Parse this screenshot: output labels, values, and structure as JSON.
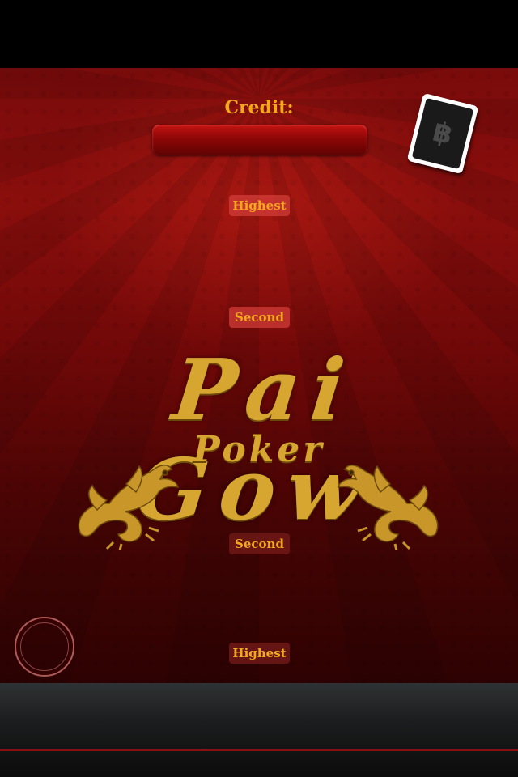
{
  "credit": {
    "label": "Credit:",
    "value": ""
  },
  "hands": {
    "dealer_high": "Highest",
    "dealer_second": "Second",
    "player_second": "Second",
    "player_high": "Highest"
  },
  "logo": {
    "title": "Pai Gow",
    "subtitle": "Poker"
  },
  "deck_button": {
    "icon": "bitcoin-card-icon",
    "glyph": "฿"
  },
  "chip_spot": {
    "icon": "chip-ring-icon"
  },
  "colors": {
    "accent_gold": "#f3a81c",
    "felt_red": "#8e0f0d",
    "logo_gold": "#d6a630"
  }
}
